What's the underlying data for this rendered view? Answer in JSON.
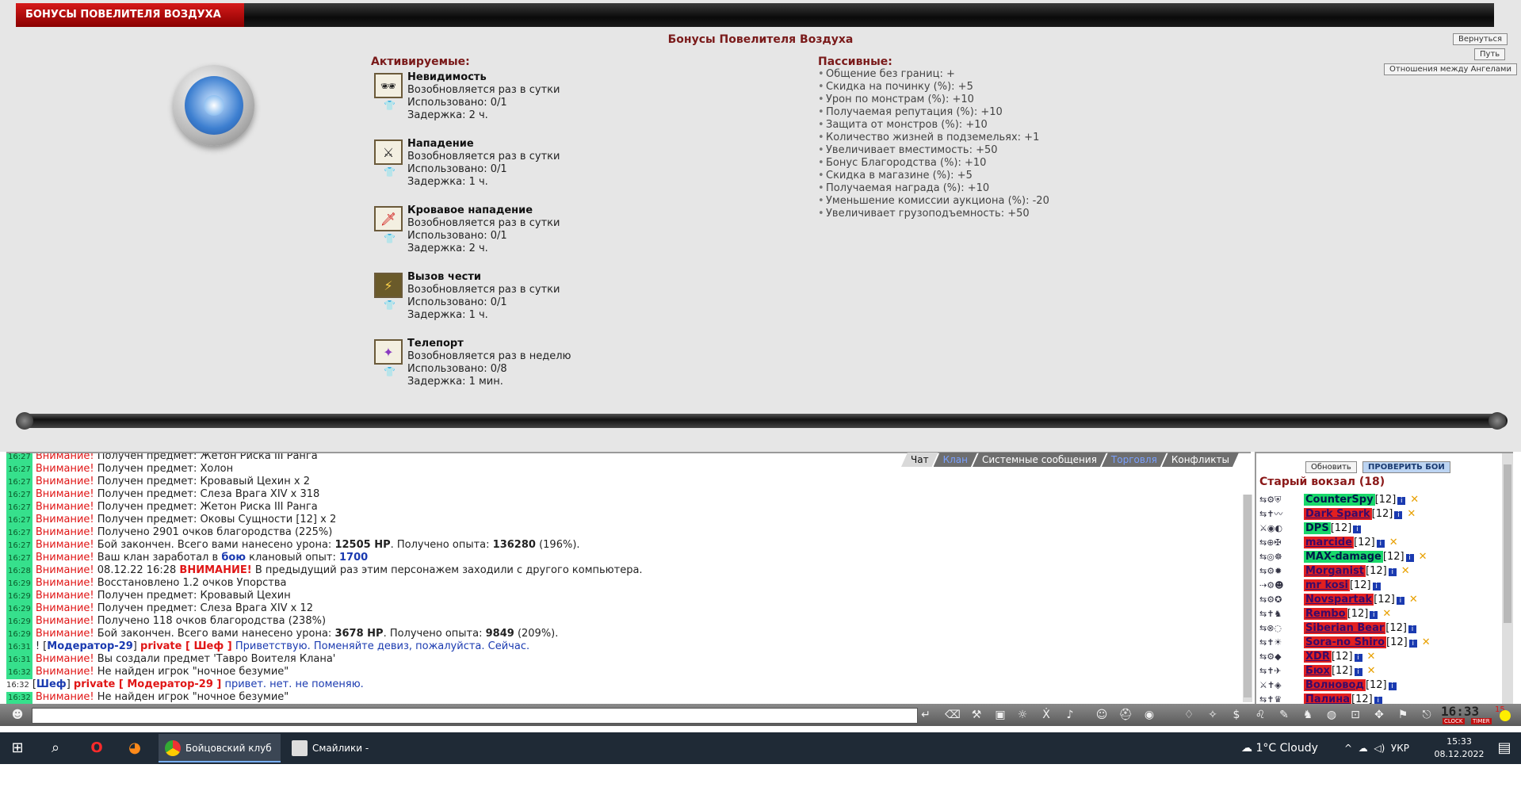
{
  "header": {
    "title": "БОНУСЫ ПОВЕЛИТЕЛЯ ВОЗДУХА",
    "page_heading": "Бонусы Повелителя Воздуха"
  },
  "side_buttons": {
    "back": "Вернуться",
    "path": "Путь",
    "angels": "Отношения между Ангелами"
  },
  "active": {
    "title": "Активируемые:",
    "skills": [
      {
        "name": "Невидимость",
        "renew": "Возобновляется раз в сутки",
        "used": "Использовано: 0/1",
        "delay": "Задержка: 2 ч.",
        "icon": "sunglasses-icon"
      },
      {
        "name": "Нападение",
        "renew": "Возобновляется раз в сутки",
        "used": "Использовано: 0/1",
        "delay": "Задержка: 1 ч.",
        "icon": "attack-icon"
      },
      {
        "name": "Кровавое нападение",
        "renew": "Возобновляется раз в сутки",
        "used": "Использовано: 0/1",
        "delay": "Задержка: 2 ч.",
        "icon": "blood-attack-icon"
      },
      {
        "name": "Вызов чести",
        "renew": "Возобновляется раз в сутки",
        "used": "Использовано: 0/1",
        "delay": "Задержка: 1 ч.",
        "icon": "honor-challenge-icon"
      },
      {
        "name": "Телепорт",
        "renew": "Возобновляется раз в неделю",
        "used": "Использовано: 0/8",
        "delay": "Задержка: 1 мин.",
        "icon": "teleport-icon"
      }
    ]
  },
  "passive": {
    "title": "Пассивные:",
    "items": [
      "Общение без границ: +",
      "Скидка на починку (%): +5",
      "Урон по монстрам (%): +10",
      "Получаемая репутация (%): +10",
      "Защита от монстров (%): +10",
      "Количество жизней в подземельях: +1",
      "Увеличивает вместимость: +50",
      "Бонус Благородства (%): +10",
      "Скидка в магазине (%): +5",
      "Получаемая награда (%): +10",
      "Уменьшение комиссии аукциона (%): -20",
      "Увеличивает грузоподъемность: +50"
    ]
  },
  "chat": {
    "tabs": [
      "Чат",
      "Клан",
      "Системные сообщения",
      "Торговля",
      "Конфликты"
    ],
    "lines": {
      "l0": {
        "ts": "16:27",
        "w": "Внимание!",
        "t": "Получен предмет: Жетон Риска III Ранга"
      },
      "l1": {
        "ts": "16:27",
        "w": "Внимание!",
        "t": "Получен предмет: Холон"
      },
      "l2": {
        "ts": "16:27",
        "w": "Внимание!",
        "t": "Получен предмет: Кровавый Цехин x 2"
      },
      "l3": {
        "ts": "16:27",
        "w": "Внимание!",
        "t": "Получен предмет: Слеза Врага XIV x 318"
      },
      "l4": {
        "ts": "16:27",
        "w": "Внимание!",
        "t": "Получен предмет: Жетон Риска III Ранга"
      },
      "l5": {
        "ts": "16:27",
        "w": "Внимание!",
        "t": "Получен предмет: Оковы Сущности [12] x 2"
      },
      "l6": {
        "ts": "16:27",
        "w": "Внимание!",
        "t": "Получено 2901 очков благородства (225%)"
      },
      "l7": {
        "ts": "16:27",
        "w": "Внимание!",
        "t1": "Бой закончен. Всего вами нанесено урона:",
        "b1": "12505 HP",
        "t2": ". Получено опыта:",
        "b2": "136280",
        "t3": "(196%)."
      },
      "l8": {
        "ts": "16:27",
        "w": "Внимание!",
        "t1": "Ваш клан заработал в",
        "b1": "бою",
        "t2": "клановый опыт:",
        "b2": "1700"
      },
      "l9": {
        "ts": "16:28",
        "w": "Внимание!",
        "t1": "08.12.22 16:28",
        "b1": "ВНИМАНИЕ!",
        "t2": "В предыдущий раз этим персонажем заходили с другого компьютера."
      },
      "l10": {
        "ts": "16:29",
        "w": "Внимание!",
        "t": "Восстановлено 1.2 очков Упорства"
      },
      "l11": {
        "ts": "16:29",
        "w": "Внимание!",
        "t": "Получен предмет: Кровавый Цехин"
      },
      "l12": {
        "ts": "16:29",
        "w": "Внимание!",
        "t": "Получен предмет: Слеза Врага XIV x 12"
      },
      "l13": {
        "ts": "16:29",
        "w": "Внимание!",
        "t": "Получено 118 очков благородства (238%)"
      },
      "l14": {
        "ts": "16:29",
        "w": "Внимание!",
        "t1": "Бой закончен. Всего вами нанесено урона:",
        "b1": "3678 HP",
        "t2": ". Получено опыта:",
        "b2": "9849",
        "t3": "(209%)."
      },
      "l15": {
        "ts": "16:31",
        "pre": "!",
        "from": "Модератор-29",
        "priv": "private [ Шеф ]",
        "msg": "Приветствую. Поменяйте девиз, пожалуйста. Сейчас."
      },
      "l16": {
        "ts": "16:31",
        "w": "Внимание!",
        "t": "Вы создали предмет 'Тавро Воителя Клана'"
      },
      "l17": {
        "ts": "16:32",
        "w": "Внимание!",
        "t": "Не найден игрок \"ночное безумие\""
      },
      "l18": {
        "ts": "16:32",
        "from": "Шеф",
        "priv": "private [ Модератор-29 ]",
        "msg": "привет. нет. не поменяю."
      },
      "l19": {
        "ts": "16:32",
        "w": "Внимание!",
        "t": "Не найден игрок \"ночное безумие\""
      }
    }
  },
  "users": {
    "refresh": "Обновить",
    "check": "ПРОВЕРИТЬ БОИ",
    "location": "Старый вокзал (18)",
    "list": [
      {
        "name": "CounterSpy",
        "lvl": "[12]",
        "color": "green",
        "x": "✕"
      },
      {
        "name": "Dark Spark",
        "lvl": "[12]",
        "color": "red",
        "x": "✕"
      },
      {
        "name": "DPS",
        "lvl": "[12]",
        "color": "green",
        "x": ""
      },
      {
        "name": "marcide",
        "lvl": "[12]",
        "color": "red",
        "x": "✕"
      },
      {
        "name": "MAX-damage",
        "lvl": "[12]",
        "color": "green",
        "x": "✕"
      },
      {
        "name": "Morganist",
        "lvl": "[12]",
        "color": "red",
        "x": "✕"
      },
      {
        "name": "mr kosi",
        "lvl": "[12]",
        "color": "red",
        "x": ""
      },
      {
        "name": "Novspartak",
        "lvl": "[12]",
        "color": "red",
        "x": "✕"
      },
      {
        "name": "Rembo",
        "lvl": "[12]",
        "color": "red",
        "x": "✕"
      },
      {
        "name": "Siberian Bear",
        "lvl": "[12]",
        "color": "red",
        "x": ""
      },
      {
        "name": "Sora-no Shiro",
        "lvl": "[12]",
        "color": "red",
        "x": "✕"
      },
      {
        "name": "XDR",
        "lvl": "[12]",
        "color": "red",
        "x": "✕"
      },
      {
        "name": "Бюх",
        "lvl": "[12]",
        "color": "red",
        "x": "✕"
      },
      {
        "name": "Волновод",
        "lvl": "[12]",
        "color": "red",
        "x": ""
      },
      {
        "name": "Палина",
        "lvl": "[12]",
        "color": "red",
        "x": ""
      }
    ]
  },
  "toolbar": {
    "clock": "16:33",
    "clock_sec": "15",
    "clock_label": "CLOCK",
    "timer_label": "TIMER"
  },
  "taskbar": {
    "app1": "Бойцовский клуб ...",
    "app2": "Смайлики - Googl...",
    "weather": "1°C  Cloudy",
    "lang": "УКР",
    "time": "15:33",
    "date": "08.12.2022"
  },
  "colors": {
    "accent_red": "#e01616",
    "title_red": "#7a1a1a",
    "green_ts": "#36e08c",
    "link_blue": "#1a3ab0"
  }
}
